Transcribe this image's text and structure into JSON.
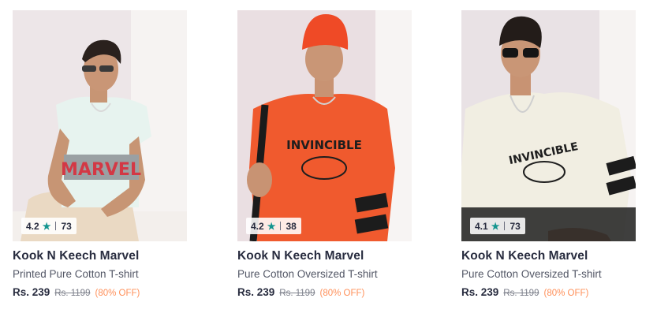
{
  "products": [
    {
      "brand": "Kook N Keech Marvel",
      "description": "Printed Pure Cotton T-shirt",
      "price": "Rs. 239",
      "mrp": "Rs. 1199",
      "discount": "(80% OFF)",
      "rating": "4.2",
      "rating_count": "73",
      "shirt_print": "MARVEL"
    },
    {
      "brand": "Kook N Keech Marvel",
      "description": "Pure Cotton Oversized T-shirt",
      "price": "Rs. 239",
      "mrp": "Rs. 1199",
      "discount": "(80% OFF)",
      "rating": "4.2",
      "rating_count": "38",
      "shirt_print": "INVINCIBLE"
    },
    {
      "brand": "Kook N Keech Marvel",
      "description": "Pure Cotton Oversized T-shirt",
      "price": "Rs. 239",
      "mrp": "Rs. 1199",
      "discount": "(80% OFF)",
      "rating": "4.1",
      "rating_count": "73",
      "shirt_print": "INVINCIBLE"
    }
  ],
  "colors": {
    "star": "#14958f",
    "discount": "#ff905a",
    "brand_text": "#282c3f"
  },
  "icons": {
    "rating": "star-icon"
  }
}
